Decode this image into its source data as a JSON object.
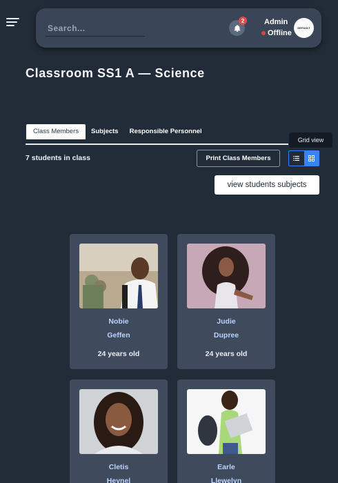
{
  "header": {
    "search_placeholder": "Search...",
    "notifications_count": "2",
    "admin_name": "Admin",
    "status": "Offline",
    "avatar_text": "DEFAULT"
  },
  "page": {
    "title": "Classroom  SS1  A  —  Science"
  },
  "tabs": [
    {
      "label": "Class Members"
    },
    {
      "label": "Subjects"
    },
    {
      "label": "Responsible Personnel"
    }
  ],
  "toolbar": {
    "count_text": "7 students in class",
    "print_label": "Print Class Members",
    "tooltip": "Grid view",
    "view_subjects_label": "view students subjects"
  },
  "students": [
    {
      "first": "Nobie",
      "last": "Geffen",
      "age": "24 years old"
    },
    {
      "first": "Judie",
      "last": "Dupree",
      "age": "24 years old"
    },
    {
      "first": "Cletis",
      "last": "Heynel",
      "age": ""
    },
    {
      "first": "Earle",
      "last": "Llewelyn",
      "age": ""
    }
  ],
  "colors": {
    "accent": "#3b82f6",
    "bg": "#222b38",
    "card": "#3f4b5c",
    "name": "#b9d3ff"
  }
}
